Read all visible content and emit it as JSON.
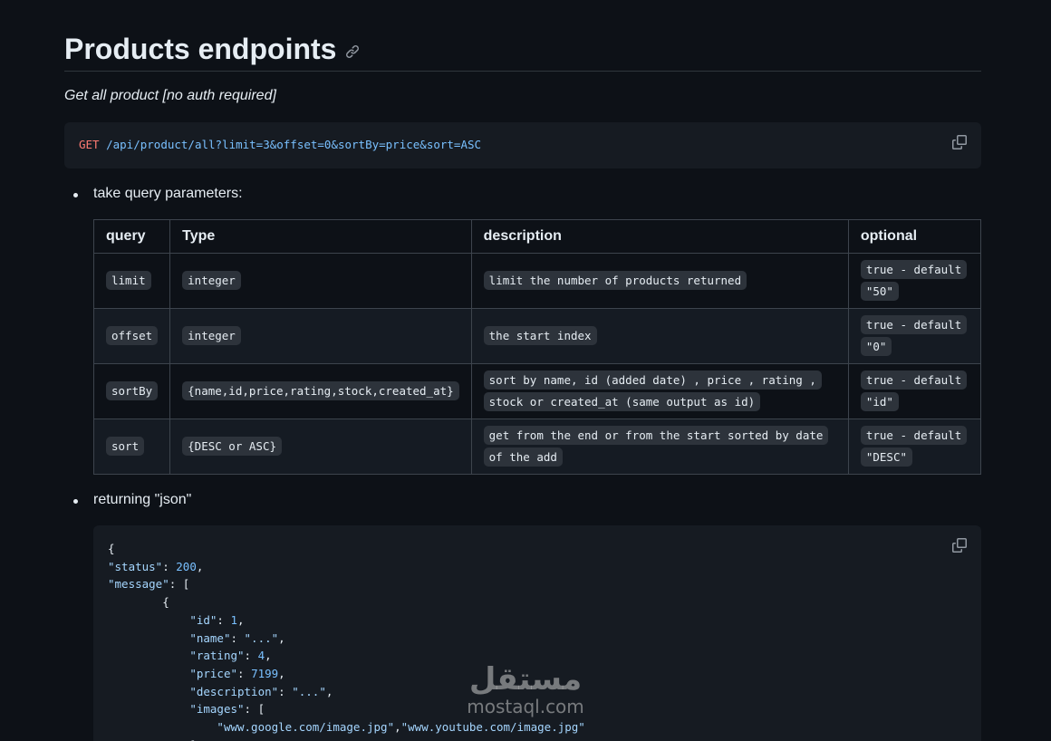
{
  "heading": "Products endpoints",
  "subtitle": "Get all product [no auth required]",
  "request": {
    "method": "GET",
    "path": "/api/product/all?limit=3&offset=0&sortBy=price&sort=ASC"
  },
  "bullets": {
    "query_params": "take query parameters:",
    "returning": "returning \"json\""
  },
  "table": {
    "headers": [
      "query",
      "Type",
      "description",
      "optional"
    ],
    "rows": [
      {
        "query": "limit",
        "type": "integer",
        "description": "limit the number of products returned",
        "optional": "true - default \"50\""
      },
      {
        "query": "offset",
        "type": "integer",
        "description": "the start index",
        "optional": "true - default \"0\""
      },
      {
        "query": "sortBy",
        "type": "{name,id,price,rating,stock,created_at}",
        "description": "sort by name, id (added date) , price , rating , stock or created_at (same output as id)",
        "optional": "true - default \"id\""
      },
      {
        "query": "sort",
        "type": "{DESC or ASC}",
        "description": "get from the end or from the start sorted by date of the add",
        "optional": "true - default \"DESC\""
      }
    ]
  },
  "json_example": {
    "open_brace": "{",
    "status_key": "\"status\"",
    "status_val": "200",
    "message_key": "\"message\"",
    "open_bracket": "[",
    "item_open": "{",
    "id_key": "\"id\"",
    "id_val": "1",
    "name_key": "\"name\"",
    "name_val": "\"...\"",
    "rating_key": "\"rating\"",
    "rating_val": "4",
    "price_key": "\"price\"",
    "price_val": "7199",
    "description_key": "\"description\"",
    "description_val": "\"...\"",
    "images_key": "\"images\"",
    "image_1": "\"www.google.com/image.jpg\"",
    "image_2": "\"www.youtube.com/image.jpg\"",
    "images_close": "],"
  },
  "watermark": {
    "arabic": "مستقل",
    "latin": "mostaql.com"
  },
  "icons": {
    "anchor": "link-icon",
    "copy": "copy-icon"
  },
  "colors": {
    "background": "#0d1117",
    "code_background": "#161b22",
    "keyword": "#ff7b72",
    "string": "#a5d6ff",
    "number": "#79c0ff"
  }
}
